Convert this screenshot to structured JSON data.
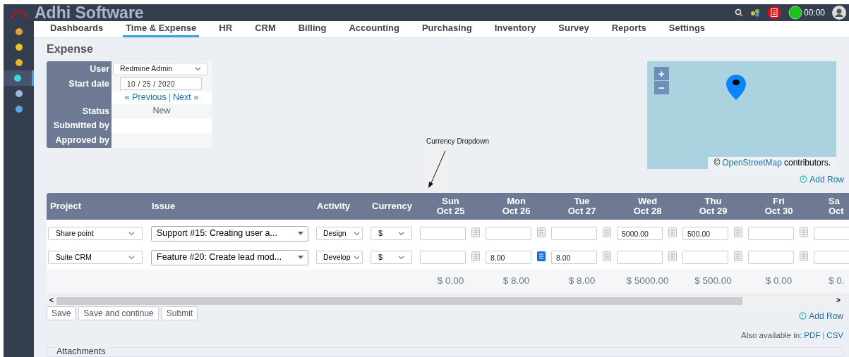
{
  "app": {
    "title": "Adhi Software",
    "timer": "00:00"
  },
  "sidebar": [
    {
      "selected": false
    },
    {
      "selected": false
    },
    {
      "selected": false
    },
    {
      "selected": true
    },
    {
      "selected": false
    },
    {
      "selected": false
    }
  ],
  "nav": [
    {
      "label": "Dashboards",
      "selected": false
    },
    {
      "label": "Time & Expense",
      "selected": true
    },
    {
      "label": "HR",
      "selected": false
    },
    {
      "label": "CRM",
      "selected": false
    },
    {
      "label": "Billing",
      "selected": false
    },
    {
      "label": "Accounting",
      "selected": false
    },
    {
      "label": "Purchasing",
      "selected": false
    },
    {
      "label": "Inventory",
      "selected": false
    },
    {
      "label": "Survey",
      "selected": false
    },
    {
      "label": "Reports",
      "selected": false
    },
    {
      "label": "Settings",
      "selected": false
    }
  ],
  "page_title": "Expense",
  "form": {
    "user_label": "User",
    "user": "Redmine Admin",
    "start_date_label": "Start date",
    "start_date": "10 / 25 / 2020",
    "previous": "« Previous",
    "separator": "|",
    "next": "Next »",
    "status_label": "Status",
    "status": "New",
    "submitted_by_label": "Submitted by",
    "approved_by_label": "Approved by"
  },
  "callout": "Currency Dropdown",
  "map": {
    "zoom_in": "+",
    "zoom_out": "−",
    "attribution_symbol": "©",
    "attribution_link": "OpenStreetMap",
    "attribution_text": "contributors."
  },
  "add_row_top": "Add Row",
  "table": {
    "columns": [
      "Project",
      "Issue",
      "Activity",
      "Currency"
    ],
    "days": [
      {
        "day": "Sun",
        "date": "Oct 25"
      },
      {
        "day": "Mon",
        "date": "Oct 26"
      },
      {
        "day": "Tue",
        "date": "Oct 27"
      },
      {
        "day": "Wed",
        "date": "Oct 28"
      },
      {
        "day": "Thu",
        "date": "Oct 29"
      },
      {
        "day": "Fri",
        "date": "Oct 30"
      },
      {
        "day": "Sa",
        "date": "Oct"
      }
    ],
    "rows": [
      {
        "project": "Share point",
        "issue": "Support #15: Creating user a...",
        "activity": "Design",
        "currency": "$",
        "cells": [
          {
            "note": false
          },
          {
            "note": false
          },
          {
            "note": false
          },
          {
            "value": "5000.00",
            "note": false
          },
          {
            "value": "500.00",
            "note": false
          },
          {
            "note": false
          },
          {}
        ]
      },
      {
        "project": "Suite CRM",
        "issue": "Feature #20: Create lead mod...",
        "activity": "Develop",
        "currency": "$",
        "cells": [
          {
            "note": false
          },
          {
            "value": "8.00",
            "note": true
          },
          {
            "value": "8.00",
            "note": false
          },
          {
            "note": false
          },
          {
            "note": false
          },
          {
            "note": false
          },
          {}
        ]
      }
    ],
    "totals": [
      "$ 0.00",
      "$ 8.00",
      "$ 8.00",
      "$ 5000.00",
      "$ 500.00",
      "$ 0.00",
      "$ 0."
    ]
  },
  "scrollbar": {
    "left": "<",
    "right": ">"
  },
  "buttons": [
    "Save",
    "Save and continue",
    "Submit"
  ],
  "add_row_bottom": "Add Row",
  "export": {
    "label": "Also available in:",
    "links": [
      "PDF",
      "CSV"
    ],
    "separator": "|"
  },
  "attachments": "Attachments"
}
